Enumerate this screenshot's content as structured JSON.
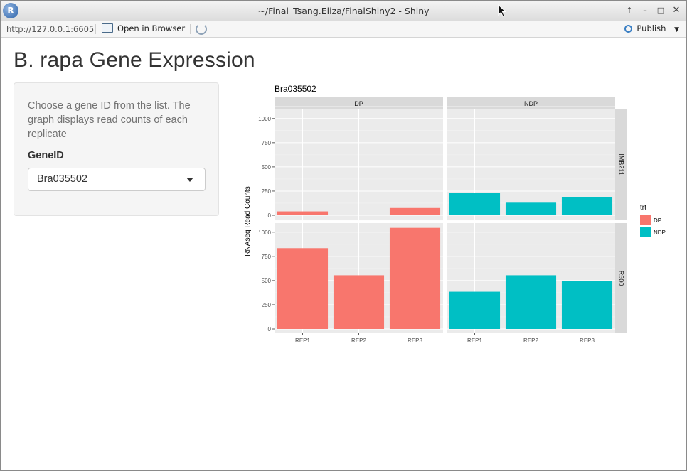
{
  "window": {
    "title": "~/Final_Tsang.Eliza/FinalShiny2 - Shiny",
    "logo_letter": "R",
    "buttons": [
      "↑",
      "–",
      "□",
      "✕"
    ]
  },
  "toolbar": {
    "url": "http://127.0.0.1:6605",
    "open_browser_label": "Open in Browser",
    "publish_label": "Publish"
  },
  "app": {
    "title": "B. rapa Gene Expression",
    "help_text": "Choose a gene ID from the list. The graph displays read counts of each replicate",
    "gene_label": "GeneID",
    "gene_selected": "Bra035502"
  },
  "colors": {
    "DP": "#F8766D",
    "NDP": "#00BFC4",
    "panel_bg": "#EBEBEB",
    "strip_bg": "#D9D9D9"
  },
  "chart_data": {
    "type": "bar",
    "title": "Bra035502",
    "ylabel": "RNAseq Read Counts",
    "xlabel": "",
    "categories": [
      "REP1",
      "REP2",
      "REP3"
    ],
    "col_facets": [
      "DP",
      "NDP"
    ],
    "row_facets": [
      "IMB211",
      "R500"
    ],
    "yticks": [
      0,
      250,
      500,
      750,
      1000
    ],
    "ylim": [
      0,
      1050
    ],
    "legend_title": "trt",
    "legend": [
      "DP",
      "NDP"
    ],
    "legend_position": "right",
    "grid": true,
    "panels": [
      {
        "row": "IMB211",
        "col": "DP",
        "series": "DP",
        "values": [
          40,
          5,
          75
        ]
      },
      {
        "row": "IMB211",
        "col": "NDP",
        "series": "NDP",
        "values": [
          230,
          130,
          190
        ]
      },
      {
        "row": "R500",
        "col": "DP",
        "series": "DP",
        "values": [
          835,
          555,
          1045
        ]
      },
      {
        "row": "R500",
        "col": "NDP",
        "series": "NDP",
        "values": [
          385,
          555,
          495
        ]
      }
    ]
  }
}
